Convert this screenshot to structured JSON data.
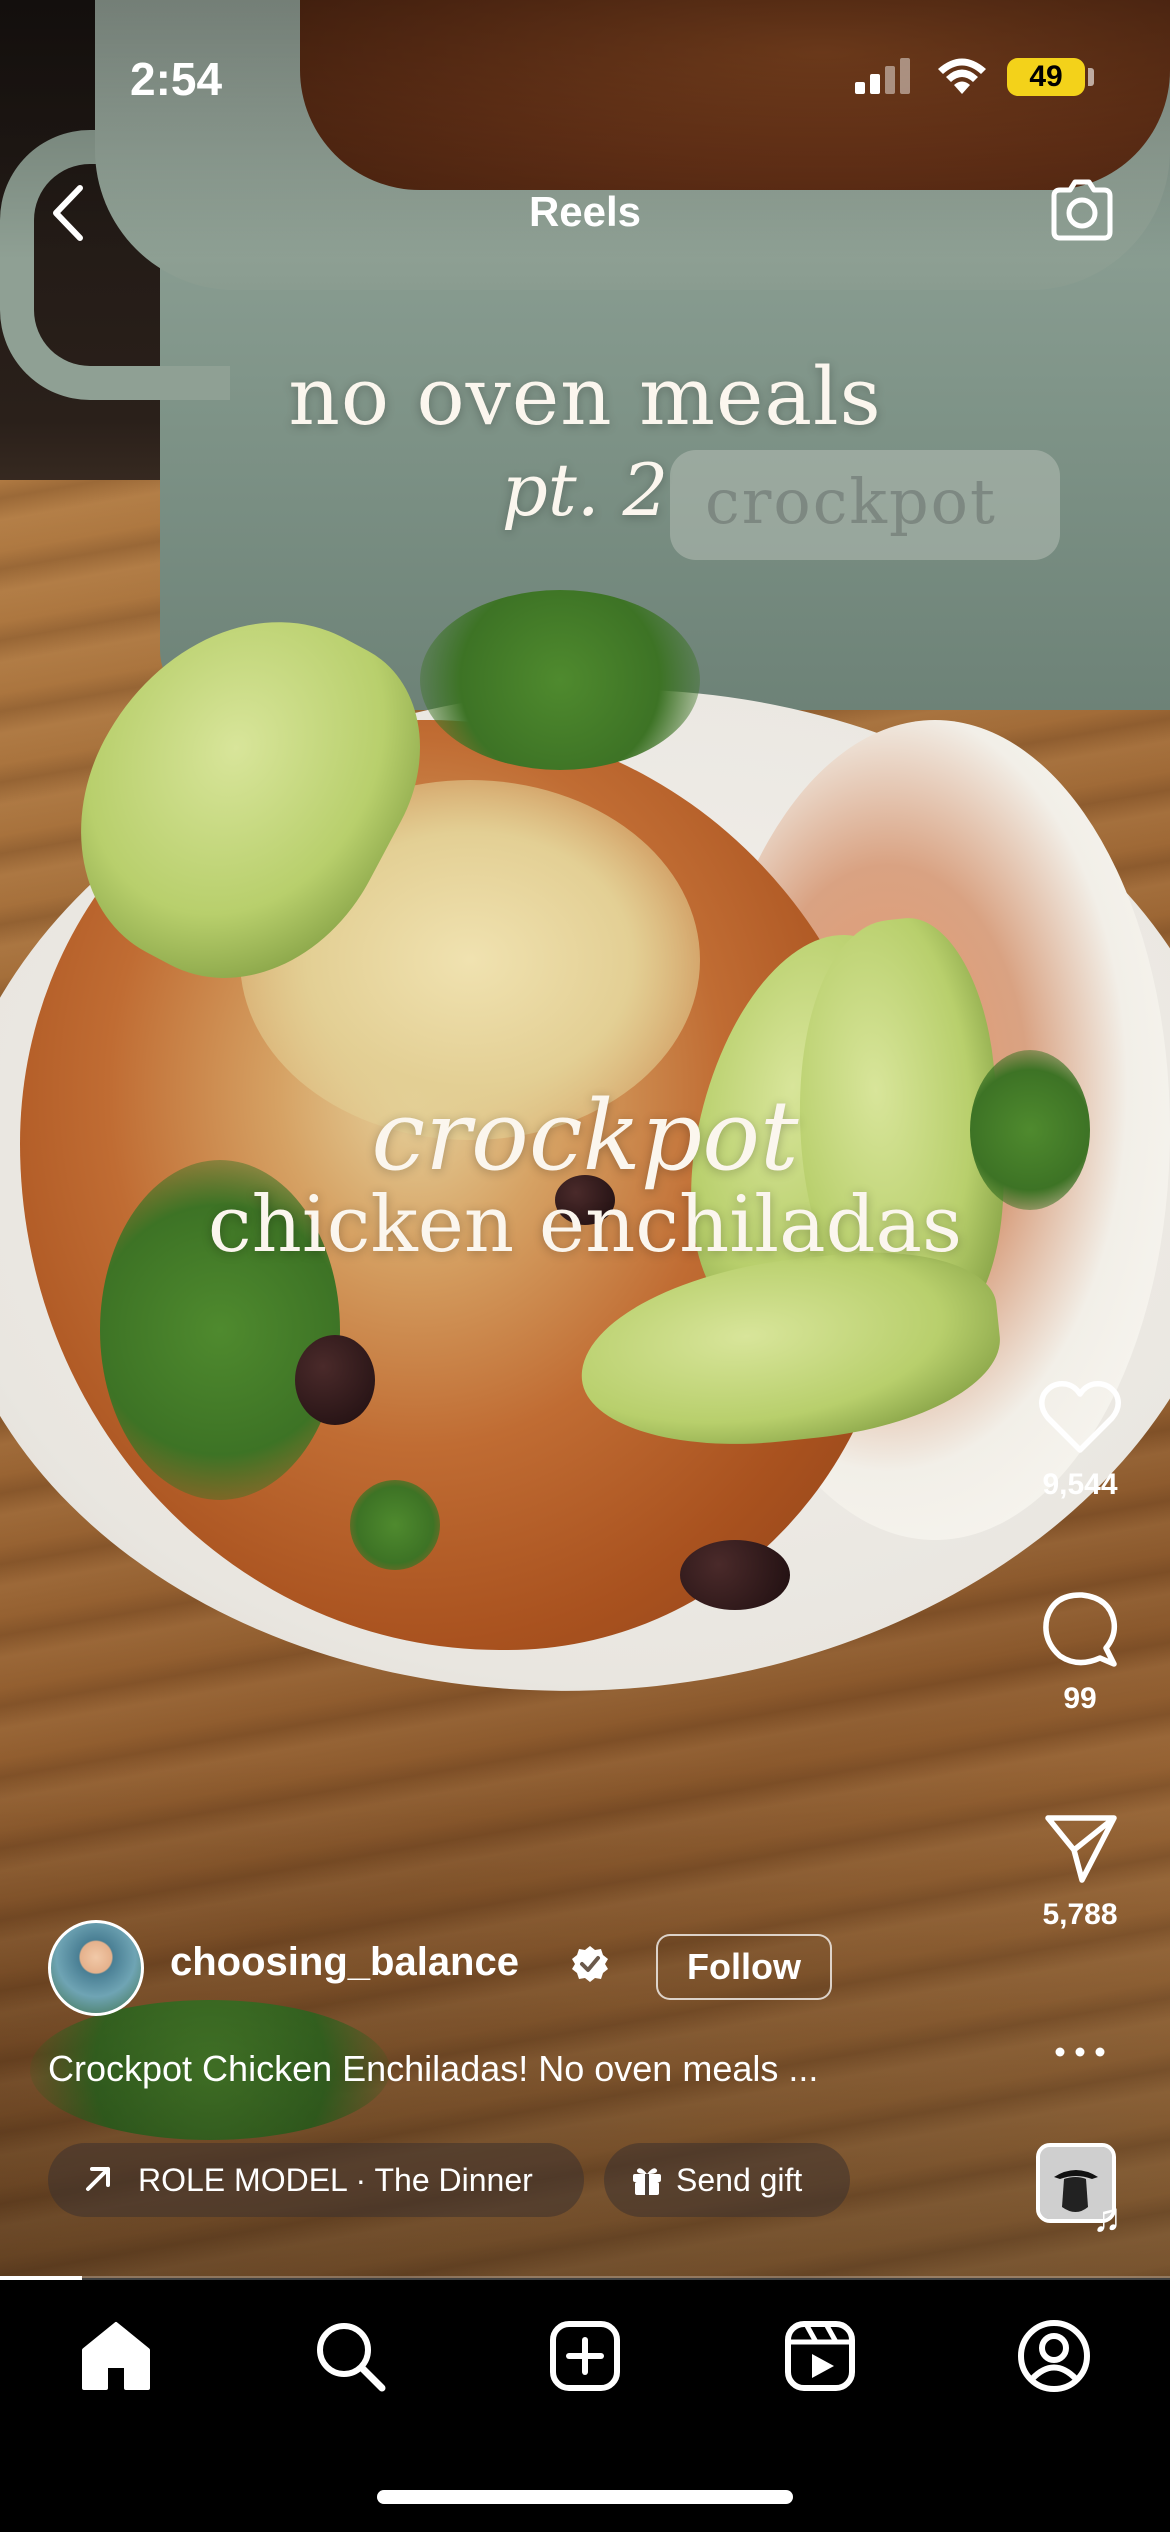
{
  "status_bar": {
    "time": "2:54",
    "battery": "49",
    "battery_color": "#f3d21a"
  },
  "header": {
    "title": "Reels",
    "back_icon": "chevron-left-icon",
    "camera_icon": "camera-icon"
  },
  "video_overlay": {
    "line1": "no oven meals",
    "line2": "pt. 2",
    "line3": "crockpot",
    "line4": "chicken enchiladas",
    "logo_text": "crockpot"
  },
  "actions": {
    "likes": "9,544",
    "comments": "99",
    "shares": "5,788",
    "like_icon": "heart-icon",
    "comment_icon": "comment-icon",
    "share_icon": "send-icon",
    "more_icon": "more-horizontal-icon"
  },
  "author": {
    "username": "choosing_balance",
    "verified": true,
    "follow_label": "Follow"
  },
  "caption": "Crockpot Chicken Enchiladas! No oven meals ...",
  "chips": {
    "audio": "ROLE MODEL · The Dinner",
    "gift": "Send gift"
  },
  "progress": 0.07,
  "bottom_nav": [
    "home-icon",
    "search-icon",
    "create-icon",
    "reels-icon",
    "profile-icon"
  ]
}
